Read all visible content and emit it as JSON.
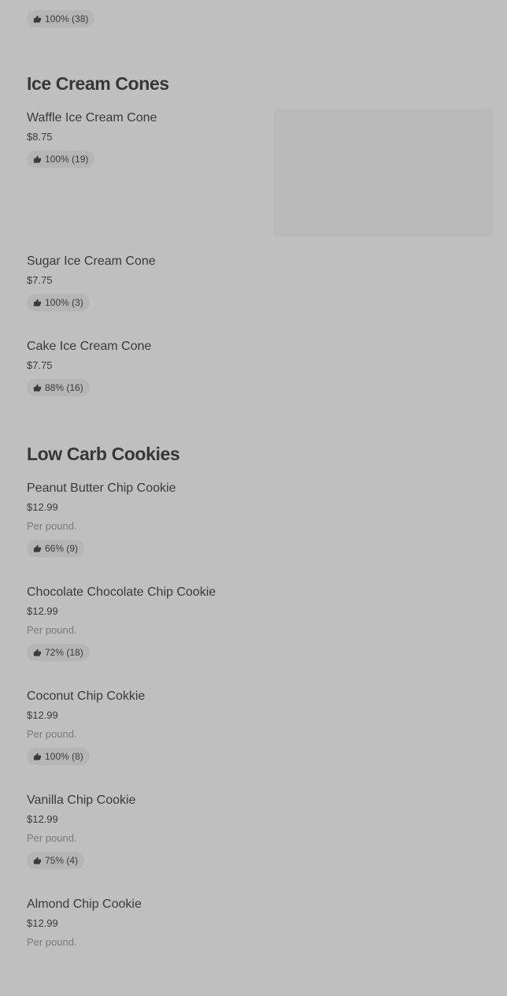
{
  "top_item": {
    "rating": "100% (38)"
  },
  "sections": [
    {
      "title": "Ice Cream Cones",
      "items": [
        {
          "name": "Waffle Ice Cream Cone",
          "price": "$8.75",
          "rating": "100% (19)"
        },
        {
          "name": "Sugar Ice Cream Cone",
          "price": "$7.75",
          "rating": "100% (3)"
        },
        {
          "name": "Cake Ice Cream Cone",
          "price": "$7.75",
          "rating": "88% (16)"
        }
      ]
    },
    {
      "title": "Low Carb Cookies",
      "items": [
        {
          "name": "Peanut Butter Chip Cookie",
          "price": "$12.99",
          "desc": "Per pound.",
          "rating": "66% (9)"
        },
        {
          "name": "Chocolate Chocolate Chip Cookie",
          "price": "$12.99",
          "desc": "Per pound.",
          "rating": "72% (18)"
        },
        {
          "name": "Coconut Chip Cokkie",
          "price": "$12.99",
          "desc": "Per pound.",
          "rating": "100% (8)"
        },
        {
          "name": "Vanilla Chip Cookie",
          "price": "$12.99",
          "desc": "Per pound.",
          "rating": "75% (4)"
        },
        {
          "name": "Almond Chip Cookie",
          "price": "$12.99",
          "desc": "Per pound."
        }
      ]
    }
  ],
  "icons": {
    "rating": "thumbs-up-icon"
  },
  "colors": {
    "page_background": "#bfbfbf",
    "pill_background": "#b5b5b5",
    "text_primary": "#3b3b3b",
    "text_secondary": "#7a7a7a"
  }
}
